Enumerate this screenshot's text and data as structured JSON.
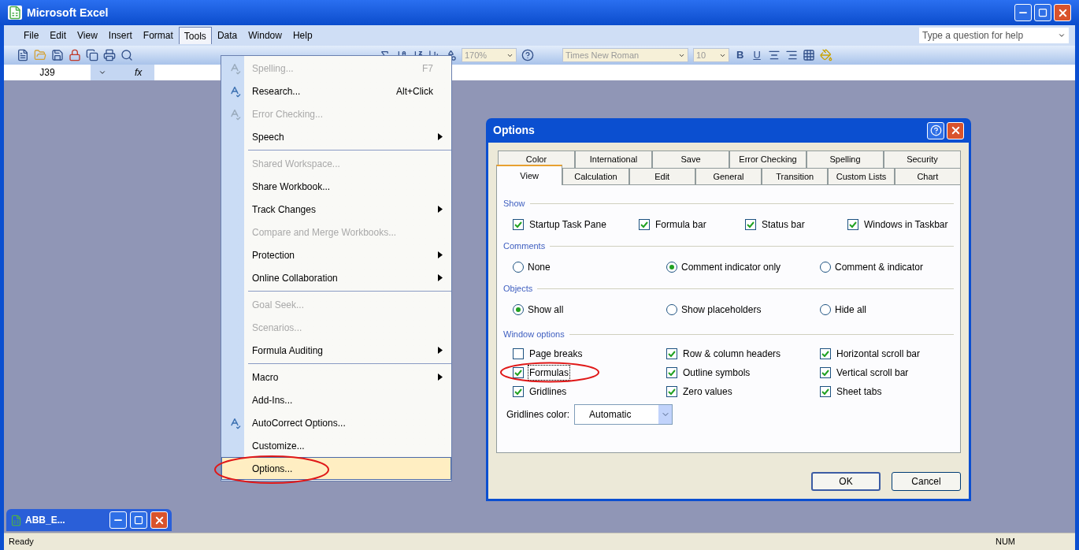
{
  "window": {
    "title": "Microsoft Excel"
  },
  "menu_bar": [
    {
      "label": "File",
      "selected": false
    },
    {
      "label": "Edit",
      "selected": false
    },
    {
      "label": "View",
      "selected": false
    },
    {
      "label": "Insert",
      "selected": false
    },
    {
      "label": "Format",
      "selected": false
    },
    {
      "label": "Tools",
      "selected": true
    },
    {
      "label": "Data",
      "selected": false
    },
    {
      "label": "Window",
      "selected": false
    },
    {
      "label": "Help",
      "selected": false
    }
  ],
  "help_box": {
    "placeholder": "Type a question for help"
  },
  "toolbar": {
    "zoom": "170%",
    "font": "Times New Roman",
    "size": "10",
    "format_buttons": [
      {
        "label": "B",
        "kind": "bold"
      },
      {
        "label": "U",
        "kind": "underline"
      }
    ]
  },
  "formula_bar": {
    "name_box": "J39",
    "function_label": "fx"
  },
  "tools_menu": [
    {
      "kind": "item",
      "label": "Spelling...",
      "shortcut": "F7",
      "disabled": true,
      "submenu": false,
      "has_icon": true,
      "selected": false
    },
    {
      "kind": "item",
      "label": "Research...",
      "shortcut": "Alt+Click",
      "disabled": false,
      "submenu": false,
      "has_icon": true,
      "selected": false
    },
    {
      "kind": "item",
      "label": "Error Checking...",
      "disabled": true,
      "submenu": false,
      "has_icon": true,
      "selected": false
    },
    {
      "kind": "item",
      "label": "Speech",
      "disabled": false,
      "submenu": true,
      "has_icon": false,
      "selected": false
    },
    {
      "kind": "separator"
    },
    {
      "kind": "item",
      "label": "Shared Workspace...",
      "disabled": true,
      "submenu": false,
      "has_icon": false,
      "selected": false
    },
    {
      "kind": "item",
      "label": "Share Workbook...",
      "disabled": false,
      "submenu": false,
      "has_icon": false,
      "selected": false
    },
    {
      "kind": "item",
      "label": "Track Changes",
      "disabled": false,
      "submenu": true,
      "has_icon": false,
      "selected": false
    },
    {
      "kind": "item",
      "label": "Compare and Merge Workbooks...",
      "disabled": true,
      "submenu": false,
      "has_icon": false,
      "selected": false
    },
    {
      "kind": "item",
      "label": "Protection",
      "disabled": false,
      "submenu": true,
      "has_icon": false,
      "selected": false
    },
    {
      "kind": "item",
      "label": "Online Collaboration",
      "disabled": false,
      "submenu": true,
      "has_icon": false,
      "selected": false
    },
    {
      "kind": "separator"
    },
    {
      "kind": "item",
      "label": "Goal Seek...",
      "disabled": true,
      "submenu": false,
      "has_icon": false,
      "selected": false
    },
    {
      "kind": "item",
      "label": "Scenarios...",
      "disabled": true,
      "submenu": false,
      "has_icon": false,
      "selected": false
    },
    {
      "kind": "item",
      "label": "Formula Auditing",
      "disabled": false,
      "submenu": true,
      "has_icon": false,
      "selected": false
    },
    {
      "kind": "separator"
    },
    {
      "kind": "item",
      "label": "Macro",
      "disabled": false,
      "submenu": true,
      "has_icon": false,
      "selected": false
    },
    {
      "kind": "item",
      "label": "Add-Ins...",
      "disabled": false,
      "submenu": false,
      "has_icon": false,
      "selected": false
    },
    {
      "kind": "item",
      "label": "AutoCorrect Options...",
      "disabled": false,
      "submenu": false,
      "has_icon": true,
      "selected": false
    },
    {
      "kind": "item",
      "label": "Customize...",
      "disabled": false,
      "submenu": false,
      "has_icon": false,
      "selected": false
    },
    {
      "kind": "item",
      "label": "Options...",
      "disabled": false,
      "submenu": false,
      "has_icon": false,
      "selected": true
    }
  ],
  "options_dialog": {
    "title": "Options",
    "tabs_back": [
      {
        "label": "Color",
        "selected": false
      },
      {
        "label": "International",
        "selected": false
      },
      {
        "label": "Save",
        "selected": false
      },
      {
        "label": "Error Checking",
        "selected": false
      },
      {
        "label": "Spelling",
        "selected": false
      },
      {
        "label": "Security",
        "selected": false
      }
    ],
    "tabs_front": [
      {
        "label": "View",
        "selected": true
      },
      {
        "label": "Calculation",
        "selected": false
      },
      {
        "label": "Edit",
        "selected": false
      },
      {
        "label": "General",
        "selected": false
      },
      {
        "label": "Transition",
        "selected": false
      },
      {
        "label": "Custom Lists",
        "selected": false
      },
      {
        "label": "Chart",
        "selected": false
      }
    ],
    "sections": [
      {
        "title": "Show",
        "controls": [
          {
            "kind": "checkbox",
            "label": "Startup Task Pane",
            "checked": true,
            "focused": false
          },
          {
            "kind": "checkbox",
            "label": "Formula bar",
            "checked": true,
            "focused": false
          },
          {
            "kind": "checkbox",
            "label": "Status bar",
            "checked": true,
            "focused": false
          },
          {
            "kind": "checkbox",
            "label": "Windows in Taskbar",
            "checked": true,
            "focused": false
          }
        ]
      },
      {
        "title": "Comments",
        "controls": [
          {
            "kind": "radio",
            "label": "None",
            "selected": false
          },
          {
            "kind": "radio",
            "label": "Comment indicator only",
            "selected": true
          },
          {
            "kind": "radio",
            "label": "Comment & indicator",
            "selected": false
          }
        ]
      },
      {
        "title": "Objects",
        "controls": [
          {
            "kind": "radio",
            "label": "Show all",
            "selected": true
          },
          {
            "kind": "radio",
            "label": "Show placeholders",
            "selected": false
          },
          {
            "kind": "radio",
            "label": "Hide all",
            "selected": false
          }
        ]
      },
      {
        "title": "Window options",
        "controls": [
          {
            "kind": "checkbox",
            "label": "Page breaks",
            "checked": false,
            "focused": false
          },
          {
            "kind": "checkbox",
            "label": "Row & column headers",
            "checked": true,
            "focused": false
          },
          {
            "kind": "checkbox",
            "label": "Horizontal scroll bar",
            "checked": true,
            "focused": false
          },
          {
            "kind": "checkbox",
            "label": "Formulas",
            "checked": true,
            "focused": true
          },
          {
            "kind": "checkbox",
            "label": "Outline symbols",
            "checked": true,
            "focused": false
          },
          {
            "kind": "checkbox",
            "label": "Vertical scroll bar",
            "checked": true,
            "focused": false
          },
          {
            "kind": "checkbox",
            "label": "Gridlines",
            "checked": true,
            "focused": false
          },
          {
            "kind": "checkbox",
            "label": "Zero values",
            "checked": true,
            "focused": false
          },
          {
            "kind": "checkbox",
            "label": "Sheet tabs",
            "checked": true,
            "focused": false
          }
        ]
      }
    ],
    "gridlines_color": {
      "label": "Gridlines color:",
      "value": "Automatic"
    },
    "buttons": [
      {
        "label": "OK",
        "default": true
      },
      {
        "label": "Cancel",
        "default": false
      }
    ]
  },
  "minimized_workbook": {
    "title": "ABB_E..."
  },
  "status_bar": {
    "text": "Ready",
    "indicator": "NUM"
  }
}
